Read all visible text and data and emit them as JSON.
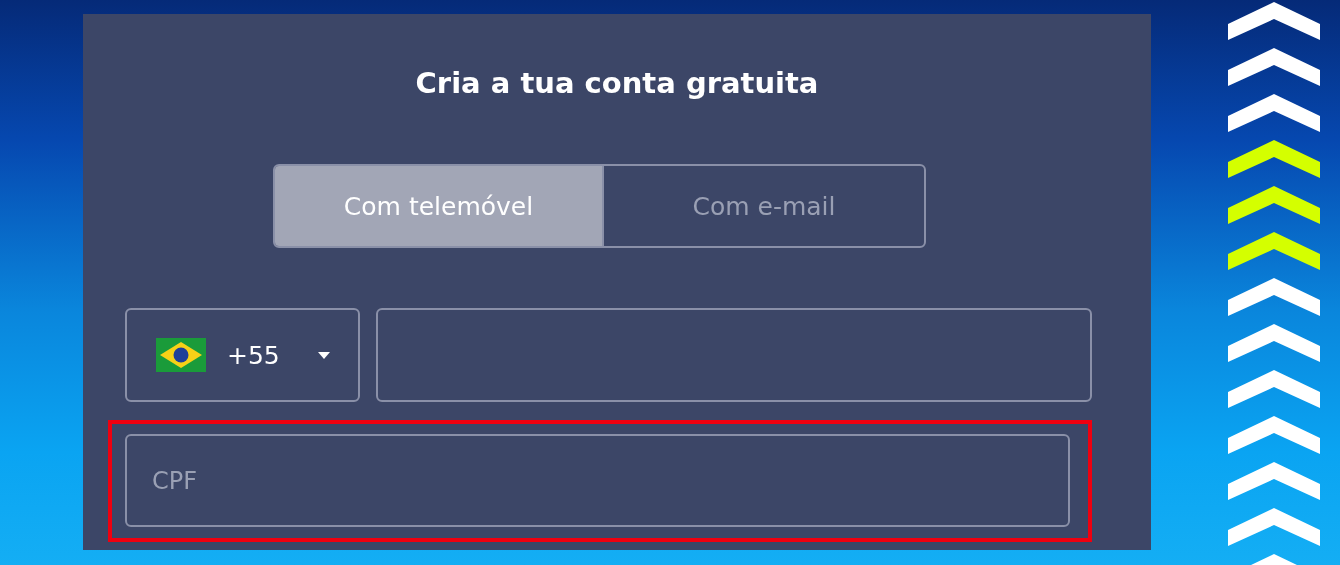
{
  "form": {
    "title": "Cria a tua conta gratuita",
    "tabs": [
      {
        "label": "Com telemóvel",
        "selected": true
      },
      {
        "label": "Com e-mail",
        "selected": false
      }
    ],
    "country_code": {
      "value": "+55"
    },
    "cpf": {
      "placeholder": "CPF",
      "highlighted": true
    }
  },
  "chevrons": [
    {
      "color": "#ffffff"
    },
    {
      "color": "#ffffff"
    },
    {
      "color": "#ffffff"
    },
    {
      "color": "#d4ff00"
    },
    {
      "color": "#d4ff00"
    },
    {
      "color": "#d4ff00"
    },
    {
      "color": "#ffffff"
    },
    {
      "color": "#ffffff"
    },
    {
      "color": "#ffffff"
    },
    {
      "color": "#ffffff"
    },
    {
      "color": "#ffffff"
    },
    {
      "color": "#ffffff"
    },
    {
      "color": "#ffffff"
    }
  ]
}
